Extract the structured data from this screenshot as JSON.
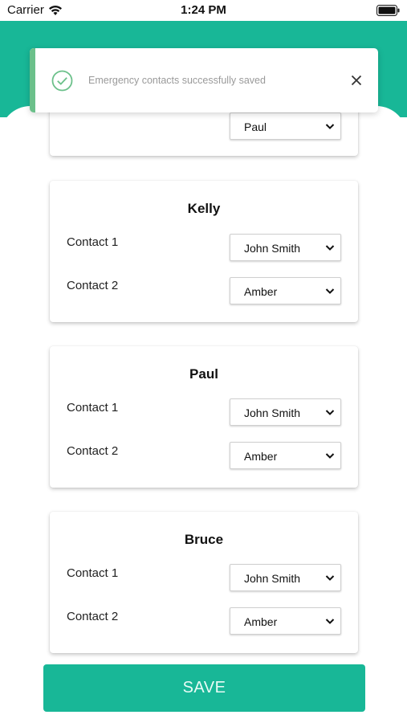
{
  "status_bar": {
    "carrier": "Carrier",
    "time": "1:24 PM"
  },
  "toast": {
    "message": "Emergency contacts successfully saved",
    "icon": "check-circle-icon",
    "accent_color": "#6bc08a"
  },
  "partial_card": {
    "select_value": "Paul"
  },
  "cards": [
    {
      "name": "Kelly",
      "rows": [
        {
          "label": "Contact 1",
          "value": "John Smith"
        },
        {
          "label": "Contact 2",
          "value": "Amber"
        }
      ]
    },
    {
      "name": "Paul",
      "rows": [
        {
          "label": "Contact 1",
          "value": "John Smith"
        },
        {
          "label": "Contact 2",
          "value": "Amber"
        }
      ]
    },
    {
      "name": "Bruce",
      "rows": [
        {
          "label": "Contact 1",
          "value": "John Smith"
        },
        {
          "label": "Contact 2",
          "value": "Amber"
        }
      ]
    }
  ],
  "save_label": "SAVE",
  "colors": {
    "primary": "#18b797",
    "toast_accent": "#6bc08a"
  }
}
